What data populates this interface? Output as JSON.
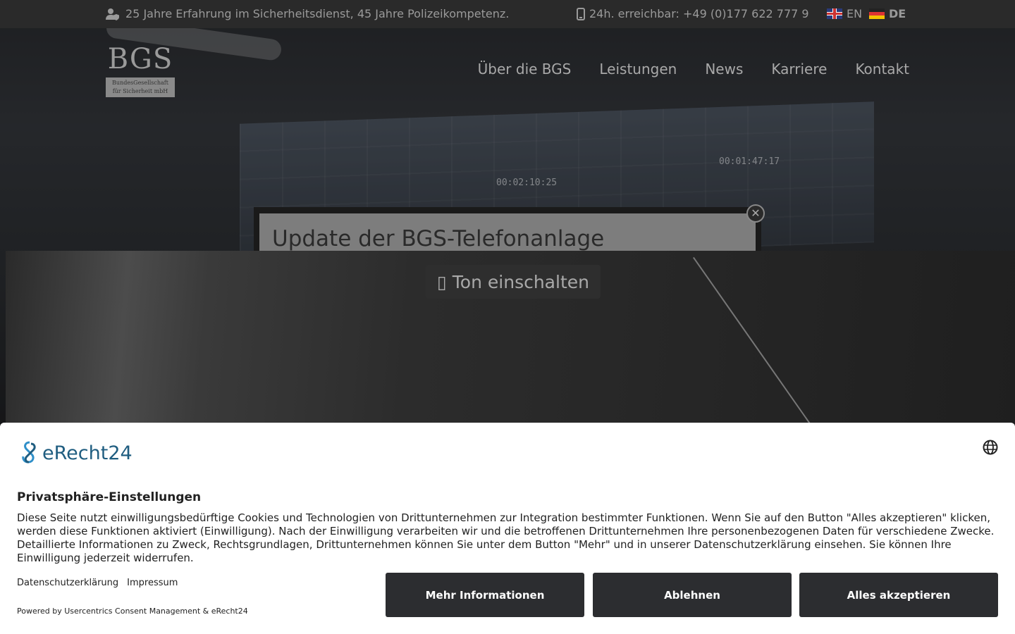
{
  "topbar": {
    "info_text": "25 Jahre Erfahrung im Sicherheitsdienst, 45 Jahre Polizeikompetenz.",
    "phone_text": "24h. erreichbar: +49 (0)177 622 777 9",
    "lang_en": "EN",
    "lang_de": "DE"
  },
  "logo": {
    "title": "BGS",
    "subtitle": "BundesGesellschaft für Sicherheit mbH"
  },
  "nav": {
    "items": [
      "Über die BGS",
      "Leistungen",
      "News",
      "Karriere",
      "Kontakt"
    ]
  },
  "hero": {
    "time_1": "00:02:10:25",
    "time_2": "00:01:47:17"
  },
  "popup": {
    "title": "Update der BGS-Telefonanlage",
    "close_icon": "close-icon",
    "sound_button": "Ton einschalten",
    "sound_icon": "speaker-icon"
  },
  "consent": {
    "brand": "eRecht24",
    "heading": "Privatsphäre-Einstellungen",
    "text": "Diese Seite nutzt einwilligungsbedürftige Cookies und Technologien von Drittunternehmen zur Integration bestimmter Funktionen. Wenn Sie auf den Button \"Alles akzeptieren\" klicken, werden diese Funktionen aktiviert (Einwilligung). Nach der Einwilligung verarbeiten wir und die betroffenen Drittunternehmen Ihre personenbezogenen Daten für verschiedene Zwecke. Detaillierte Informationen zu Zweck, Rechtsgrundlagen, Drittunternehmen können Sie unter dem Button \"Mehr\" und in unserer Datenschutzerklärung einsehen. Sie können Ihre Einwilligung jederzeit widerrufen.",
    "link_privacy": "Datenschutzerklärung",
    "link_imprint": "Impressum",
    "powered": "Powered by Usercentrics Consent Management & eRecht24",
    "btn_more": "Mehr Informationen",
    "btn_decline": "Ablehnen",
    "btn_accept": "Alles akzeptieren"
  }
}
